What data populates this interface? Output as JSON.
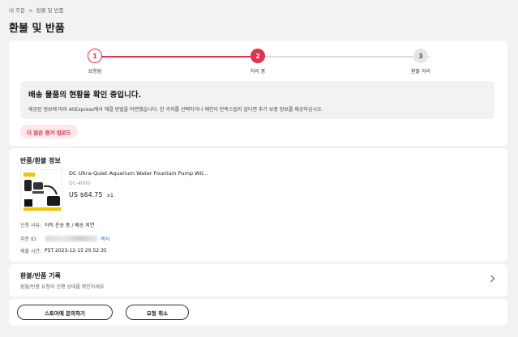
{
  "breadcrumb": {
    "items": [
      "내 주문",
      ">",
      "환불 및 반품"
    ]
  },
  "page_title": "환불 및 반품",
  "stepper": {
    "steps": [
      {
        "number": "1",
        "label": "요청됨"
      },
      {
        "number": "2",
        "label": "처리 중"
      },
      {
        "number": "3",
        "label": "환불 처리"
      }
    ],
    "current_step": 2
  },
  "notice": {
    "title": "배송 물품의 현황을 확인 중입니다.",
    "text": "제공된 정보에 따라 AliExpress에서 해결 방법을 마련했습니다. 한 가지를 선택하거나 제안이 만족스럽지 않다면 추가 보충 정보를 제공하십시오."
  },
  "upload_button_label": "더 많은 증거 업로드",
  "info": {
    "title": "반품/환불 정보",
    "product": {
      "name": "DC Ultra-Quiet Aquarium Water Fountain Pump Wit...",
      "sku": "DC-4000",
      "price": "US $64.75",
      "qty": "x1"
    },
    "reason_label": "신청 사유:",
    "reason_value": "아직 운송 중 / 배송 지연",
    "order_id_label": "주문 ID:",
    "copy_label": "복사",
    "submitted_label": "제출 시간:",
    "submitted_value": "PST 2023-12-15 20:52:35"
  },
  "history": {
    "title": "환불/반품 기록",
    "subtitle": "환불/반품 요청의 진행 상태를 확인하세요"
  },
  "actions": {
    "contact_label": "스토어에 문의하기",
    "cancel_label": "요청 취소"
  },
  "colors": {
    "accent": "#e0324b",
    "link": "#1a6ee0"
  }
}
